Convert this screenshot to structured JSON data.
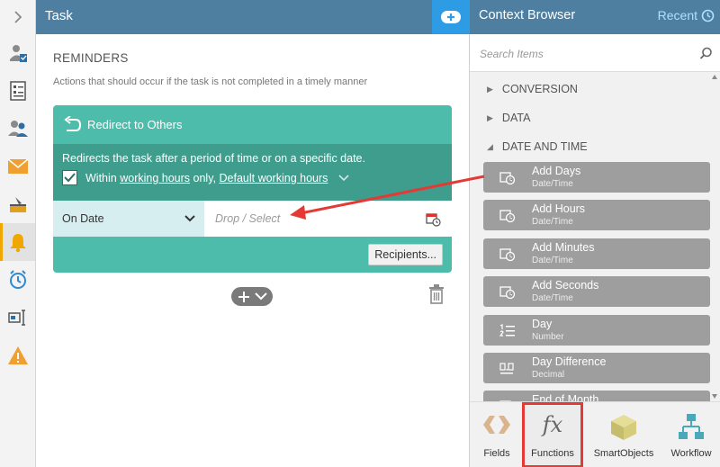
{
  "task": {
    "title": "Task",
    "section_title": "REMINDERS",
    "section_desc": "Actions that should occur if the task is not completed in a timely manner",
    "card": {
      "title": "Redirect to Others",
      "info_line1": "Redirects the task after a period of time or on a specific date.",
      "within": "Within",
      "working_hours": "working hours",
      "only": "only,",
      "default_hours": "Default working hours",
      "select_value": "On Date",
      "drop_placeholder": "Drop / Select",
      "recipients_label": "Recipients..."
    }
  },
  "context": {
    "title": "Context Browser",
    "recent": "Recent",
    "search_placeholder": "Search Items",
    "categories": [
      "CONVERSION",
      "DATA",
      "DATE AND TIME"
    ],
    "functions": [
      {
        "name": "Add Days",
        "type": "Date/Time"
      },
      {
        "name": "Add Hours",
        "type": "Date/Time"
      },
      {
        "name": "Add Minutes",
        "type": "Date/Time"
      },
      {
        "name": "Add Seconds",
        "type": "Date/Time"
      },
      {
        "name": "Day",
        "type": "Number"
      },
      {
        "name": "Day Difference",
        "type": "Decimal"
      },
      {
        "name": "End of Month",
        "type": ""
      }
    ],
    "tabs": [
      {
        "label": "Fields"
      },
      {
        "label": "Functions"
      },
      {
        "label": "SmartObjects"
      },
      {
        "label": "Workflow"
      }
    ]
  },
  "colors": {
    "header": "#4e7fa0",
    "accent": "#2e9be5",
    "card": "#4dbcab",
    "card_dark": "#3e9d8d",
    "highlight": "#e53935"
  }
}
